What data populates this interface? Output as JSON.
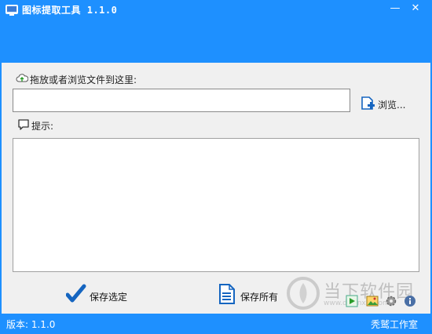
{
  "window": {
    "title": "图标提取工具 1.1.0",
    "minimize_glyph": "—",
    "close_glyph": "✕"
  },
  "drop": {
    "label": "拖放或者浏览文件到这里:",
    "path_value": ""
  },
  "browse": {
    "label": "浏览..."
  },
  "hint": {
    "label": "提示:",
    "content": ""
  },
  "actions": {
    "save_selected": "保存选定",
    "save_all": "保存所有"
  },
  "toolbar_icons": [
    "play-icon",
    "image-icon",
    "gear-icon",
    "info-icon"
  ],
  "watermark": {
    "text": "当下软件园",
    "url": "www.downxia.com"
  },
  "status": {
    "version": "版本: 1.1.0",
    "studio": "秃鹫工作室"
  },
  "colors": {
    "titlebar": "#1e90ff",
    "client": "#f0f0f0",
    "accent": "#1565c0"
  }
}
